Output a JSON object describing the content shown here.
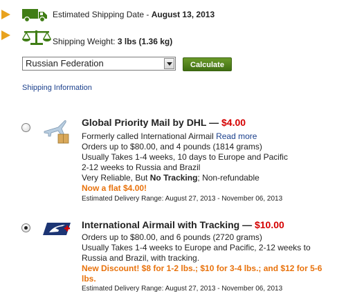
{
  "shipping_date": {
    "label": "Estimated Shipping Date -",
    "value": "August 13, 2013"
  },
  "shipping_weight": {
    "label": "Shipping Weight:",
    "value": "3 lbs (1.36 kg)"
  },
  "country_select": {
    "selected": "Russian Federation"
  },
  "calculate_button": {
    "label": "Calculate"
  },
  "shipping_info_link": "Shipping Information",
  "options": [
    {
      "title": "Global Priority Mail by DHL",
      "price": "$4.00",
      "selected": false,
      "icon": "airplane-box-icon",
      "desc_prefix": "Formerly called International Airmail",
      "read_more": "Read more",
      "lines": [
        "Orders up to $80.00, and 4 pounds (1814 grams)",
        "Usually Takes 1-4 weeks, 10 days to Europe and Pacific",
        "2-12 weeks to Russia and Brazil"
      ],
      "reliability_prefix": "Very Reliable, But",
      "reliability_bold": "No Tracking",
      "reliability_suffix": "; Non-refundable",
      "promo": "Now a flat $4.00!",
      "delivery_range": "Estimated Delivery Range: August 27, 2013 - November 06, 2013"
    },
    {
      "title": "International Airmail with Tracking",
      "price": "$10.00",
      "selected": true,
      "icon": "usps-eagle-icon",
      "lines": [
        "Orders up to $80.00, and 6 pounds (2720 grams)",
        "Usually Takes 1-4 weeks to Europe and Pacific, 2-12 weeks to",
        "Russia and Brazil, with tracking."
      ],
      "promo_line1": "New Discount! $8 for 1-2 lbs.; $10 for 3-4 lbs.; and $12 for 5-6",
      "promo_line2": "lbs.",
      "delivery_range": "Estimated Delivery Range: August 27, 2013 - November 06, 2013"
    }
  ],
  "colors": {
    "arrow": "#e8a21e",
    "icon_green": "#3f7d14",
    "price_red": "#d50000",
    "promo_orange": "#e8720c",
    "link_blue": "#1a3f8c",
    "button_green": "#4f8219"
  }
}
